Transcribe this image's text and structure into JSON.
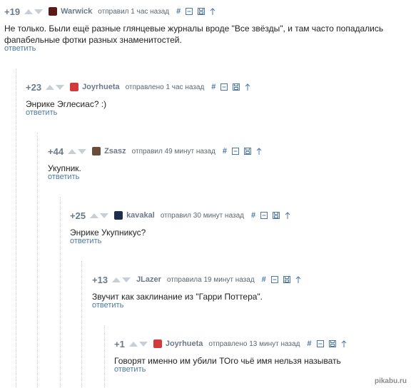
{
  "comments": [
    {
      "rating": "+19",
      "author": "Warwick",
      "avatar_color": "#5a1a1a",
      "meta": "отправил 1 час назад",
      "text_lines": [
        "Не только. Были ещё разные глянцевые журналы вроде \"Все звёзды\", и там часто попадались",
        "фапабельные фотки разных знаменитостей."
      ],
      "reply": "ответить",
      "icons": [
        "hash-icon",
        "minus-icon",
        "save-icon",
        "up-arrow-icon"
      ]
    },
    {
      "rating": "+23",
      "author": "Joyrhueta",
      "avatar_color": "#d23b3b",
      "meta": "отправлено 1 час назад",
      "text_lines": [
        "Энрике Эглесиас? :)"
      ],
      "reply": "ответить",
      "icons": [
        "hash-icon",
        "minus-icon",
        "save-icon",
        "up-arrow-icon"
      ]
    },
    {
      "rating": "+44",
      "author": "Zsasz",
      "avatar_color": "#6b4b3a",
      "meta": "отправил 49 минут назад",
      "text_lines": [
        "Укупник."
      ],
      "reply": "ответить",
      "icons": [
        "hash-icon",
        "minus-icon",
        "save-icon",
        "up-arrow-icon"
      ]
    },
    {
      "rating": "+25",
      "author": "kavakal",
      "avatar_color": "#1e2f4a",
      "meta": "отправил 30 минут назад",
      "text_lines": [
        "Энрике Укупникус?"
      ],
      "reply": "ответить",
      "icons": [
        "hash-icon",
        "minus-icon",
        "save-icon",
        "up-arrow-icon"
      ]
    },
    {
      "rating": "+13",
      "author": "JLazer",
      "avatar_color": "",
      "meta": "отправила 19 минут назад",
      "text_lines": [
        "Звучит как заклинание из \"Гарри Поттера\"."
      ],
      "reply": "ответить",
      "icons": [
        "hash-icon",
        "minus-icon",
        "save-icon",
        "up-arrow-icon"
      ]
    },
    {
      "rating": "+1",
      "author": "Joyrhueta",
      "avatar_color": "#d23b3b",
      "meta": "отправлено 13 минут назад",
      "text_lines": [
        "Говорят именно им убили ТОго чьё имя нельзя называть"
      ],
      "reply": "ответить",
      "icons": [
        "hash-icon",
        "minus-icon",
        "save-icon",
        "up-arrow-icon"
      ]
    }
  ],
  "watermark": "pikabu.ru"
}
